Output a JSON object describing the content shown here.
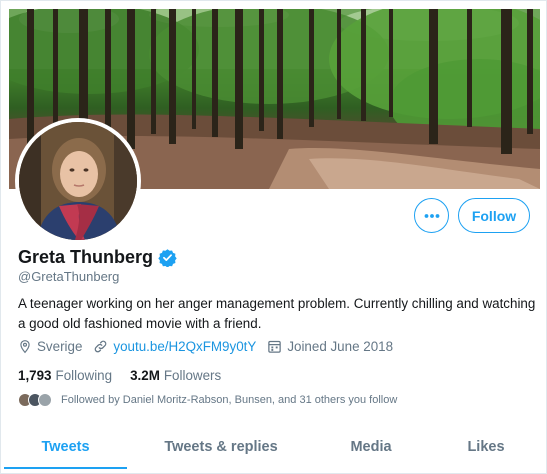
{
  "profile": {
    "name": "Greta Thunberg",
    "handle": "@GretaThunberg",
    "bio": "A teenager working on her anger management problem. Currently chilling and watching a good old fashioned movie with a friend.",
    "location": "Sverige",
    "website": "youtu.be/H2QxFM9y0tY",
    "joined": "Joined June 2018"
  },
  "actions": {
    "follow_label": "Follow",
    "more_icon": "more-dots-icon"
  },
  "stats": {
    "following_count": "1,793",
    "following_label": "Following",
    "followers_count": "3.2M",
    "followers_label": "Followers"
  },
  "followed_by": {
    "text": "Followed by Daniel Moritz-Rabson, Bunsen, and 31 others you follow"
  },
  "tabs": [
    {
      "label": "Tweets",
      "active": true
    },
    {
      "label": "Tweets & replies",
      "active": false
    },
    {
      "label": "Media",
      "active": false
    },
    {
      "label": "Likes",
      "active": false
    }
  ],
  "colors": {
    "accent": "#1da1f2",
    "link": "#1b95e0",
    "muted": "#657786",
    "text": "#14171a"
  }
}
